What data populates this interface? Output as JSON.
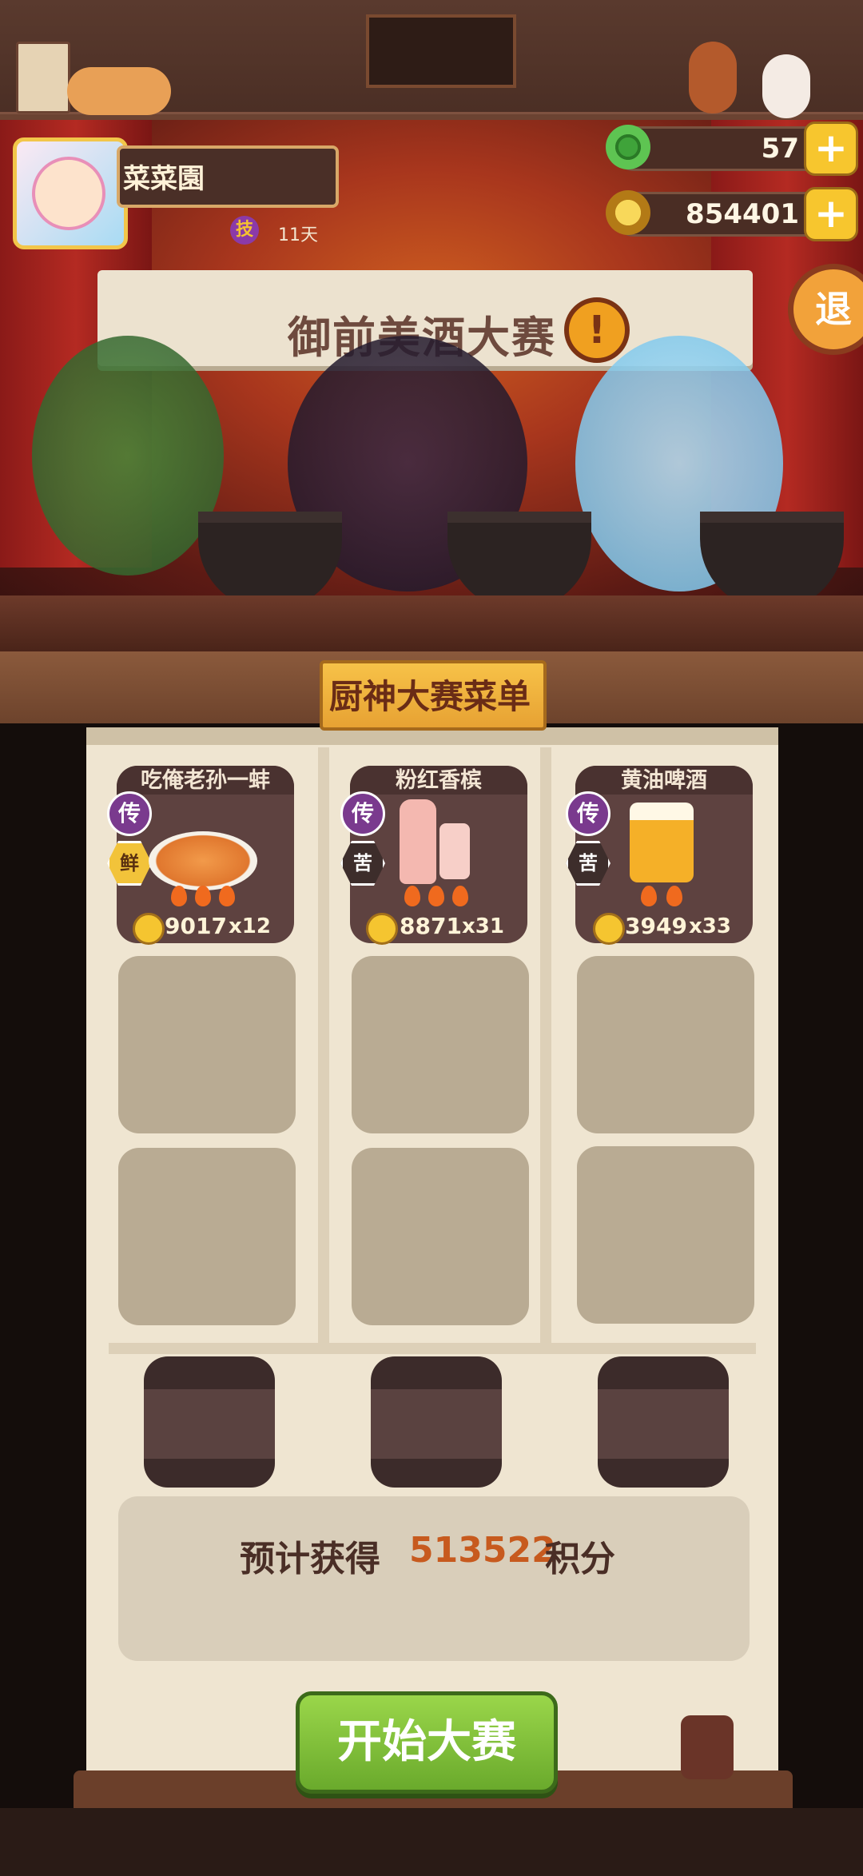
{
  "player": {
    "name": "菜菜園",
    "skill_badge": "技",
    "days": "11天"
  },
  "currency": [
    {
      "name": "jade",
      "icon": "jade-icon",
      "value": "57",
      "color": "#3fa33a"
    },
    {
      "name": "coins",
      "icon": "coin-icon",
      "value": "854401",
      "color": "#f5c530"
    }
  ],
  "exit_label": "退",
  "stage": {
    "banner_title": "御前美酒大赛",
    "alert_icon": "!"
  },
  "menu": {
    "title": "厨神大赛菜单",
    "dishes": [
      {
        "name": "吃俺老孙一蚌",
        "legend_badge": "传",
        "taste": "鲜",
        "price": "9017",
        "qty": "x12"
      },
      {
        "name": "粉红香槟",
        "legend_badge": "传",
        "taste": "苦",
        "price": "8871",
        "qty": "x31"
      },
      {
        "name": "黄油啤酒",
        "legend_badge": "传",
        "taste": "苦",
        "price": "3949",
        "qty": "x33"
      }
    ]
  },
  "score": {
    "label": "预计获得",
    "value": "513522",
    "unit": "积分"
  },
  "start_button": "开始大赛"
}
